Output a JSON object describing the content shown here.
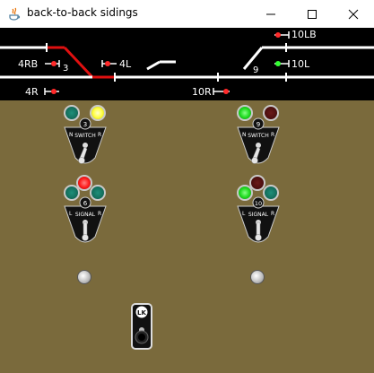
{
  "window": {
    "title": "back-to-back sidings",
    "minimize_icon": "minimize-icon",
    "maximize_icon": "maximize-icon",
    "close_icon": "close-icon"
  },
  "track_labels": {
    "route_4RB": "4RB",
    "route_4L": "4L",
    "route_4R": "4R",
    "route_10LB": "10LB",
    "route_10L": "10L",
    "route_10R": "10R",
    "track_3": "3",
    "track_9": "9"
  },
  "colors": {
    "background": "#7a6a3c",
    "track": "#ffffff",
    "occupied_track": "#e01010",
    "signal_red": "#ff2a2a",
    "signal_green": "#33ff33",
    "lamp_yellow": "#ffff44",
    "lamp_green_lit": "#22dd22",
    "lamp_dark_green": "#0d5a4a",
    "lamp_dark_red": "#4a0a0a",
    "lamp_red_lit": "#ff2020"
  },
  "levers": {
    "switch_3": {
      "label": "SWITCH",
      "number": "3",
      "left": "N",
      "right": "R"
    },
    "signal_6": {
      "label": "SIGNAL",
      "number": "6",
      "left": "L",
      "right": "R"
    },
    "switch_9": {
      "label": "SWITCH",
      "number": "9",
      "left": "N",
      "right": "R"
    },
    "signal_10": {
      "label": "SIGNAL",
      "number": "10",
      "left": "L",
      "right": "R"
    }
  },
  "lock_lever": {
    "label": "LK"
  }
}
